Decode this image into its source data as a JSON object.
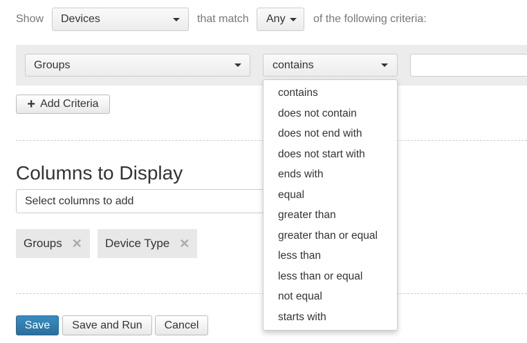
{
  "filter": {
    "show_label": "Show",
    "entity": "Devices",
    "match_label": "that match",
    "match": "Any",
    "suffix": "of the following criteria:"
  },
  "criteria": {
    "field": "Groups",
    "operator": "contains",
    "value": "",
    "add_label": "Add Criteria"
  },
  "operator_options": [
    "contains",
    "does not contain",
    "does not end with",
    "does not start with",
    "ends with",
    "equal",
    "greater than",
    "greater than or equal",
    "less than",
    "less than or equal",
    "not equal",
    "starts with"
  ],
  "columns": {
    "title": "Columns to Display",
    "placeholder": "Select columns to add",
    "chips": [
      "Groups",
      "Device Type"
    ]
  },
  "actions": {
    "save": "Save",
    "save_run": "Save and Run",
    "cancel": "Cancel"
  },
  "colors": {
    "primary": "#2f7bab"
  }
}
